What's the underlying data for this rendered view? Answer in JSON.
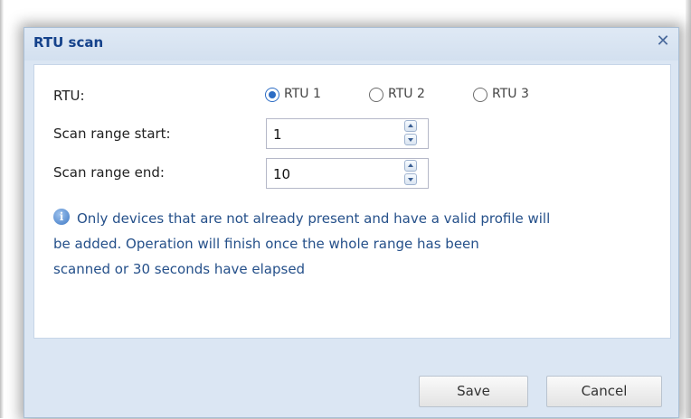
{
  "dialog": {
    "title": "RTU scan",
    "close_icon": "close-icon"
  },
  "form": {
    "rtu_label": "RTU:",
    "rtu_options": [
      {
        "label": "RTU 1",
        "checked": true
      },
      {
        "label": "RTU 2",
        "checked": false
      },
      {
        "label": "RTU 3",
        "checked": false
      }
    ],
    "scan_start_label": "Scan range start:",
    "scan_start_value": "1",
    "scan_end_label": "Scan range end:",
    "scan_end_value": "10"
  },
  "info": {
    "icon": "info-icon",
    "lines": [
      "Only devices that are not already present and have a valid profile will",
      "be added. Operation will finish once the whole range has been",
      "scanned or 30 seconds have elapsed"
    ]
  },
  "footer": {
    "save_label": "Save",
    "cancel_label": "Cancel"
  },
  "colors": {
    "title_text": "#15428b",
    "info_text": "#25508a",
    "dialog_frame": "#dbe6f3",
    "radio_accent": "#2c6cc4"
  }
}
